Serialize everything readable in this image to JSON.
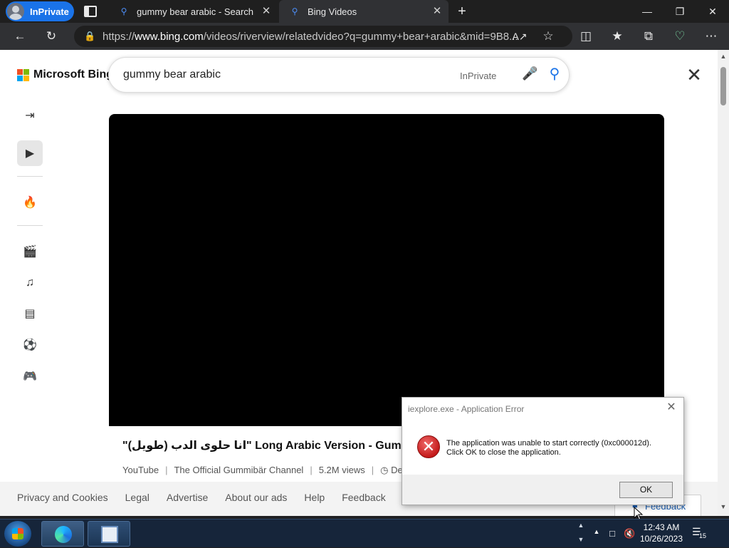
{
  "browser": {
    "inprivate_label": "InPrivate",
    "tabs": [
      {
        "title": "gummy bear arabic - Search"
      },
      {
        "title": "Bing Videos"
      }
    ],
    "url_prefix": "https://",
    "url_host": "www.bing.com",
    "url_path": "/videos/riverview/relatedvideo?q=gummy+bear+arabic&mid=9B8..."
  },
  "page": {
    "logo_text": "Microsoft Bing",
    "logo_colors": [
      "#f25022",
      "#7fba00",
      "#00a4ef",
      "#ffb900"
    ],
    "search_query": "gummy bear arabic",
    "search_badge": "InPrivate",
    "video_title": "\"انا حلوى الدب (طويل)\" Long Arabic Version - Gummy Bear S",
    "video_meta": {
      "source": "YouTube",
      "channel": "The Official Gummibär Channel",
      "views": "5.2M views",
      "date": "Dec"
    },
    "footer_links": [
      "Privacy and Cookies",
      "Legal",
      "Advertise",
      "About our ads",
      "Help",
      "Feedback"
    ],
    "feedback_button": "Feedback"
  },
  "dialog": {
    "title": "iexplore.exe - Application Error",
    "message_line1": "The application was unable to start correctly (0xc000012d).",
    "message_line2": "Click OK to close the application.",
    "ok_label": "OK"
  },
  "taskbar": {
    "time": "12:43 AM",
    "date": "10/26/2023",
    "notification_count": "15"
  }
}
